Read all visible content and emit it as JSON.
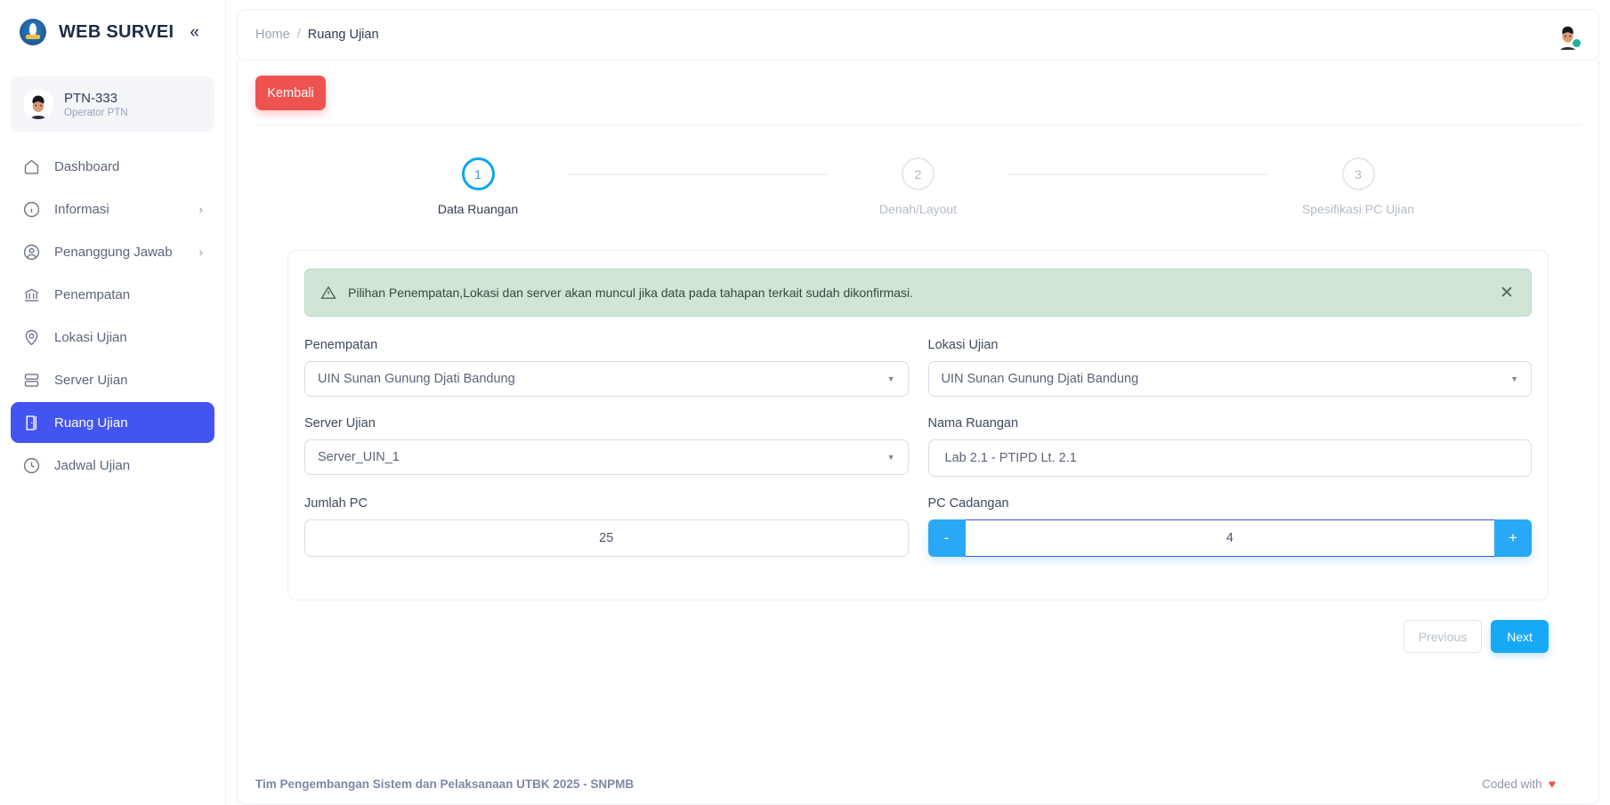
{
  "sidebar": {
    "brand": {
      "title": "WEB SURVEI",
      "collapse_icon": "chevrons-left-icon"
    },
    "profile": {
      "name": "PTN-333",
      "role": "Operator PTN"
    },
    "items": [
      {
        "label": "Dashboard",
        "icon": "home-icon",
        "active": false,
        "expandable": false
      },
      {
        "label": "Informasi",
        "icon": "info-icon",
        "active": false,
        "expandable": true
      },
      {
        "label": "Penanggung Jawab",
        "icon": "user-circle-icon",
        "active": false,
        "expandable": true
      },
      {
        "label": "Penempatan",
        "icon": "bank-icon",
        "active": false,
        "expandable": false
      },
      {
        "label": "Lokasi Ujian",
        "icon": "map-pin-icon",
        "active": false,
        "expandable": false
      },
      {
        "label": "Server Ujian",
        "icon": "server-icon",
        "active": false,
        "expandable": false
      },
      {
        "label": "Ruang Ujian",
        "icon": "door-icon",
        "active": true,
        "expandable": false
      },
      {
        "label": "Jadwal Ujian",
        "icon": "clock-icon",
        "active": false,
        "expandable": false
      }
    ]
  },
  "topbar": {
    "breadcrumb": {
      "home": "Home",
      "separator": "/",
      "current": "Ruang Ujian"
    },
    "avatar": "user-avatar"
  },
  "toolbar": {
    "back_label": "Kembali"
  },
  "stepper": {
    "steps": [
      {
        "number": "1",
        "label": "Data Ruangan",
        "active": true
      },
      {
        "number": "2",
        "label": "Denah/Layout",
        "active": false
      },
      {
        "number": "3",
        "label": "Spesifikasi PC Ujian",
        "active": false
      }
    ]
  },
  "alert": {
    "icon": "warning-triangle-icon",
    "message": "Pilihan Penempatan,Lokasi dan server akan muncul jika data pada tahapan terkait sudah dikonfirmasi.",
    "close_icon": "close-icon",
    "bg_color": "#cfe5d6"
  },
  "form": {
    "penempatan": {
      "label": "Penempatan",
      "value": "UIN Sunan Gunung Djati Bandung"
    },
    "lokasi_ujian": {
      "label": "Lokasi Ujian",
      "value": "UIN Sunan Gunung Djati Bandung"
    },
    "server_ujian": {
      "label": "Server Ujian",
      "value": "Server_UIN_1"
    },
    "nama_ruangan": {
      "label": "Nama Ruangan",
      "value": "Lab 2.1 - PTIPD Lt. 2.1"
    },
    "jumlah_pc": {
      "label": "Jumlah PC",
      "value": "25"
    },
    "pc_cadangan": {
      "label": "PC Cadangan",
      "value": "4",
      "minus_label": "-",
      "plus_label": "+"
    }
  },
  "nav_buttons": {
    "previous": "Previous",
    "next": "Next"
  },
  "footer": {
    "left": "Tim Pengembangan Sistem dan Pelaksanaan UTBK 2025 - SNPMB",
    "right": "Coded with",
    "heart": "♥"
  },
  "colors": {
    "accent_blue": "#4355f0",
    "step_blue": "#09a7f0",
    "danger_red": "#ef5350",
    "online_green": "#19b39a"
  }
}
